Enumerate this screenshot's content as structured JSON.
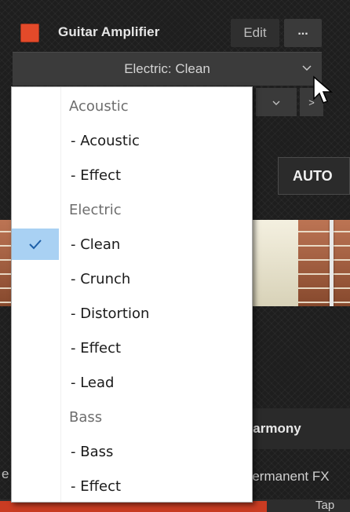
{
  "header": {
    "title": "Guitar Amplifier",
    "edit_label": "Edit",
    "more_label": "...",
    "power_color": "#e34a2a"
  },
  "preset": {
    "value": "Electric: Clean",
    "chevron": "chevron-down-icon"
  },
  "sub_bar": {
    "chevron": "chevron-down-icon",
    "next_label": ">"
  },
  "auto_label": "AUTO",
  "harmony_label": "Harmony",
  "fx_label": "Permanent FX",
  "left_edge_text": "e",
  "bottom_tab_text": "Tap",
  "dropdown": {
    "items": [
      {
        "label": "Acoustic",
        "type": "group"
      },
      {
        "label": "- Acoustic",
        "type": "item"
      },
      {
        "label": "- Effect",
        "type": "item"
      },
      {
        "label": "Electric",
        "type": "group"
      },
      {
        "label": "- Clean",
        "type": "item",
        "selected": true
      },
      {
        "label": "- Crunch",
        "type": "item"
      },
      {
        "label": "- Distortion",
        "type": "item"
      },
      {
        "label": "- Effect",
        "type": "item"
      },
      {
        "label": "- Lead",
        "type": "item"
      },
      {
        "label": "Bass",
        "type": "group"
      },
      {
        "label": "- Bass",
        "type": "item"
      },
      {
        "label": "- Effect",
        "type": "item"
      }
    ],
    "selected_label": "- Clean",
    "check_icon": "checkmark-icon"
  }
}
